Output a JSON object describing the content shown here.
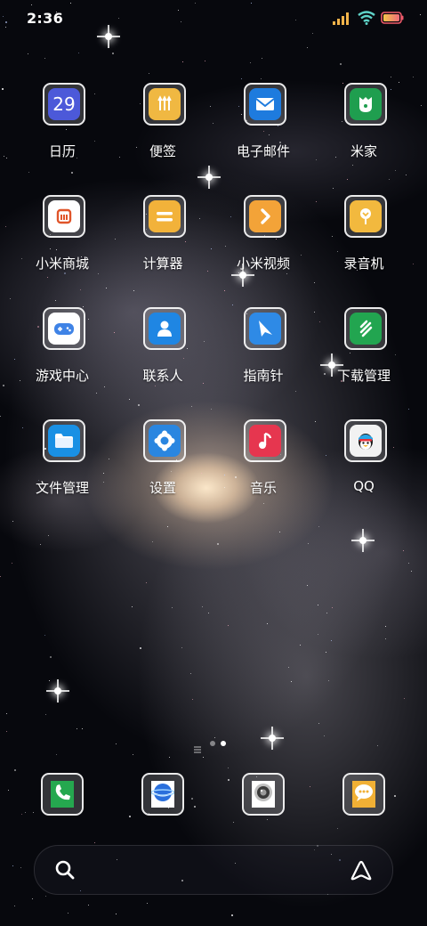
{
  "status_bar": {
    "time": "2:36",
    "icons": [
      "signal-icon",
      "wifi-icon",
      "battery-icon"
    ]
  },
  "colors": {
    "calendar": "#4c59d9",
    "notes": "#f0b842",
    "mail": "#1e7bde",
    "mijia": "#1f9e4f",
    "mall": "#e0552a",
    "calculator": "#f2b23a",
    "video": "#f3a338",
    "recorder": "#f2b93e",
    "games": "#3f83e6",
    "contacts": "#1f86e3",
    "compass": "#2e8ae6",
    "downloads": "#22a550",
    "files": "#1990e4",
    "settings": "#2a86e0",
    "music": "#e6364f",
    "qq": "#f2f2f2",
    "phone": "#25a84f",
    "browser": "#2a6fdc",
    "camera": "#d9d9d9",
    "messages": "#f1b035"
  },
  "apps": [
    {
      "label": "日历",
      "icon": "calendar-icon",
      "glyph": "29"
    },
    {
      "label": "便签",
      "icon": "notes-icon"
    },
    {
      "label": "电子邮件",
      "icon": "mail-icon"
    },
    {
      "label": "米家",
      "icon": "mijia-icon"
    },
    {
      "label": "小米商城",
      "icon": "mi-mall-icon",
      "glyph": "mi"
    },
    {
      "label": "计算器",
      "icon": "calculator-icon"
    },
    {
      "label": "小米视频",
      "icon": "video-icon"
    },
    {
      "label": "录音机",
      "icon": "recorder-icon"
    },
    {
      "label": "游戏中心",
      "icon": "gamepad-icon"
    },
    {
      "label": "联系人",
      "icon": "contacts-icon"
    },
    {
      "label": "指南针",
      "icon": "compass-icon"
    },
    {
      "label": "下载管理",
      "icon": "downloads-icon"
    },
    {
      "label": "文件管理",
      "icon": "folder-icon"
    },
    {
      "label": "设置",
      "icon": "settings-gear-icon"
    },
    {
      "label": "音乐",
      "icon": "music-note-icon"
    },
    {
      "label": "QQ",
      "icon": "qq-penguin-icon"
    }
  ],
  "page_indicator": {
    "pages": 3,
    "current": 3
  },
  "dock": [
    {
      "name": "phone",
      "icon": "phone-icon"
    },
    {
      "name": "browser",
      "icon": "browser-icon"
    },
    {
      "name": "camera",
      "icon": "camera-icon"
    },
    {
      "name": "messages",
      "icon": "messages-icon"
    }
  ],
  "search_bar": {
    "icons": [
      "search-icon",
      "assistant-icon"
    ]
  }
}
